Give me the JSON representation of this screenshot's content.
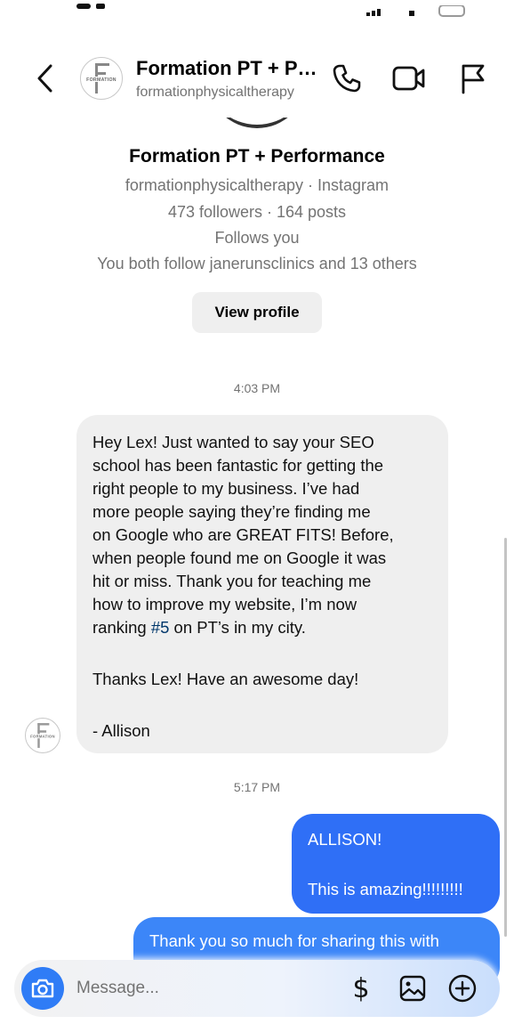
{
  "header": {
    "title": "Formation PT + Performance",
    "username": "formationphysicaltherapy",
    "avatar_text": "FORMATION",
    "back_icon": "chevron-left-icon",
    "call_icon": "phone-icon",
    "video_icon": "video-camera-icon",
    "report_icon": "flag-icon"
  },
  "profile": {
    "name": "Formation PT + Performance",
    "handle_line": "formationphysicaltherapy · Instagram",
    "stats_line": "473 followers · 164 posts",
    "follows_line": "Follows you",
    "mutual_line": "You both follow janerunsclinics and 13 others",
    "view_profile_label": "View profile"
  },
  "messages": {
    "timestamp_1": "4:03 PM",
    "incoming_1": {
      "line_1": "Hey Lex! Just wanted to say your SEO",
      "line_2": "school has been fantastic for getting the",
      "line_3": "right people to my business. I’ve had",
      "line_4": "more people saying they’re finding me",
      "line_5": "on Google who are GREAT FITS! Before,",
      "line_6": "when people found me on Google it was",
      "line_7": "hit or miss. Thank you for teaching me",
      "line_8": "how to improve my website, I’m now",
      "line_9_pre": "ranking ",
      "line_9_tag": "#5",
      "line_9_post": " on PT’s in my city.",
      "thanks": "Thanks Lex! Have an awesome day!",
      "signature": "- Allison"
    },
    "timestamp_2": "5:17 PM",
    "outgoing_1": {
      "line_1": "ALLISON!",
      "line_2": "This is amazing!!!!!!!!!"
    },
    "outgoing_2": {
      "line_1": "Thank you so much for sharing this with"
    }
  },
  "composer": {
    "placeholder": "Message...",
    "camera_icon": "camera-icon",
    "dollar_symbol": "$",
    "gallery_icon": "image-icon",
    "add_icon": "plus-circle-icon"
  },
  "colors": {
    "outgoing_bubble": "#2f6ff6",
    "incoming_bubble": "#efefef",
    "secondary_text": "#737373",
    "hashtag": "#00376b"
  }
}
